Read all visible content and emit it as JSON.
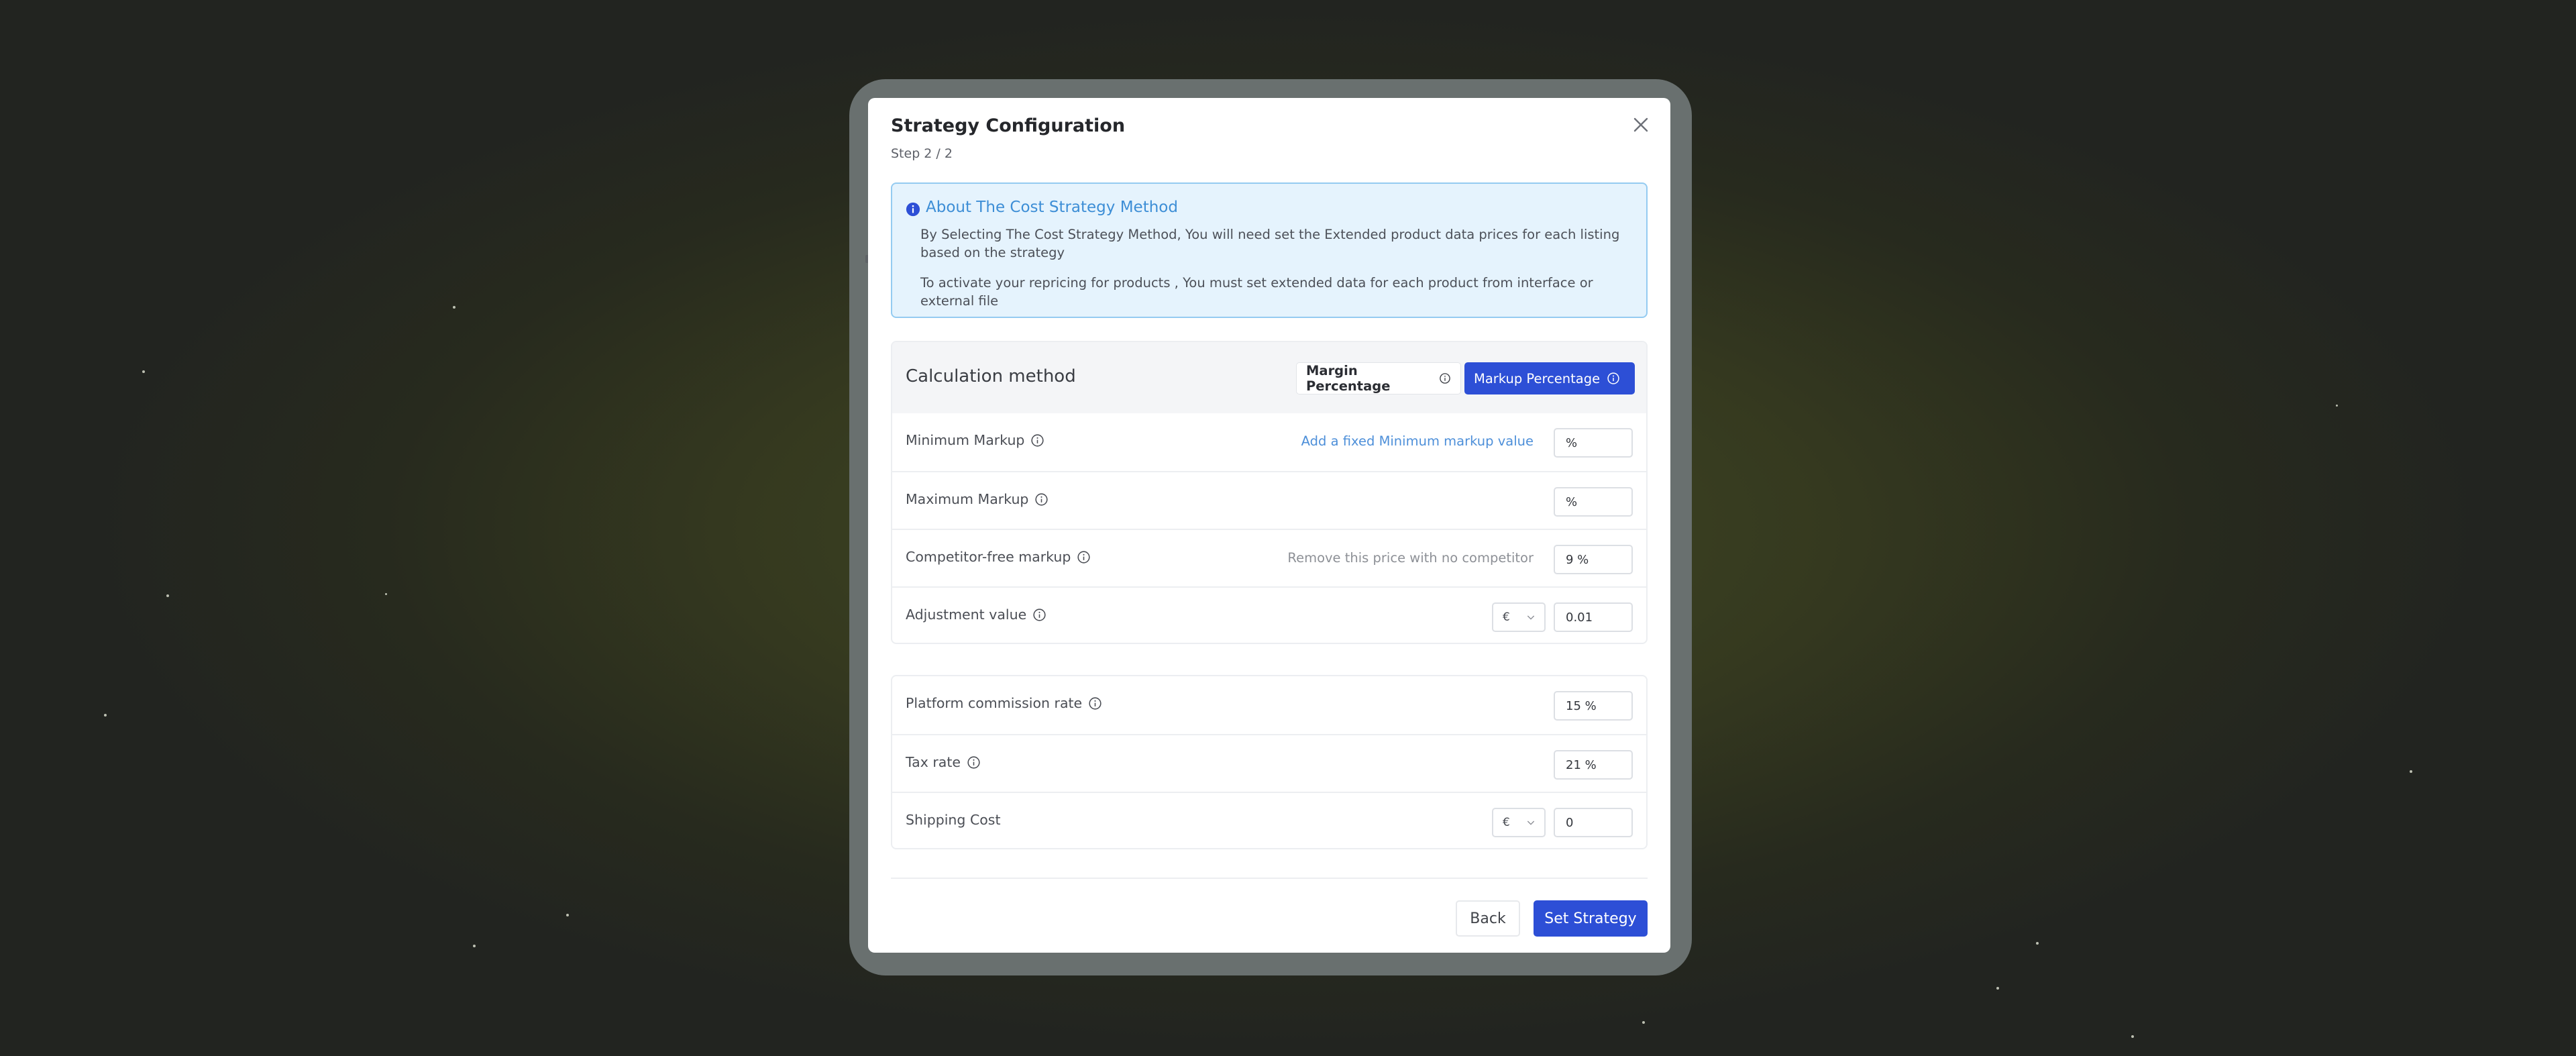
{
  "modal": {
    "title": "Strategy Configuration",
    "step": "Step 2 / 2",
    "close_icon": "close-icon"
  },
  "info": {
    "icon": "info-filled-icon",
    "title": "About The Cost Strategy Method",
    "line1": "By Selecting The Cost Strategy Method, You will need set the Extended product data prices for each listing based on the strategy",
    "line2": "To activate your repricing for products , You must set extended data for each product from interface or external file"
  },
  "calculation": {
    "title": "Calculation method",
    "options": [
      {
        "label": "Margin Percentage",
        "selected": false
      },
      {
        "label": "Markup Percentage",
        "selected": true
      }
    ],
    "rows": {
      "minimum_markup": {
        "label": "Minimum Markup",
        "link": "Add a fixed Minimum markup value",
        "value": "%"
      },
      "maximum_markup": {
        "label": "Maximum Markup",
        "value": "%"
      },
      "competitor_free": {
        "label": "Competitor-free markup",
        "action": "Remove this price with no competitor",
        "value": "9 %"
      },
      "adjustment": {
        "label": "Adjustment value",
        "currency": "€",
        "value": "0.01"
      }
    }
  },
  "costs": {
    "commission": {
      "label": "Platform commission rate",
      "value": "15 %"
    },
    "tax": {
      "label": "Tax rate",
      "value": "21 %"
    },
    "shipping": {
      "label": "Shipping Cost",
      "currency": "€",
      "value": "0"
    }
  },
  "footer": {
    "back_label": "Back",
    "set_label": "Set Strategy"
  },
  "colors": {
    "primary": "#2d4fd6",
    "info_bg": "#e5f3fd",
    "info_border": "#94cbf1",
    "info_title": "#3d8ed6"
  }
}
